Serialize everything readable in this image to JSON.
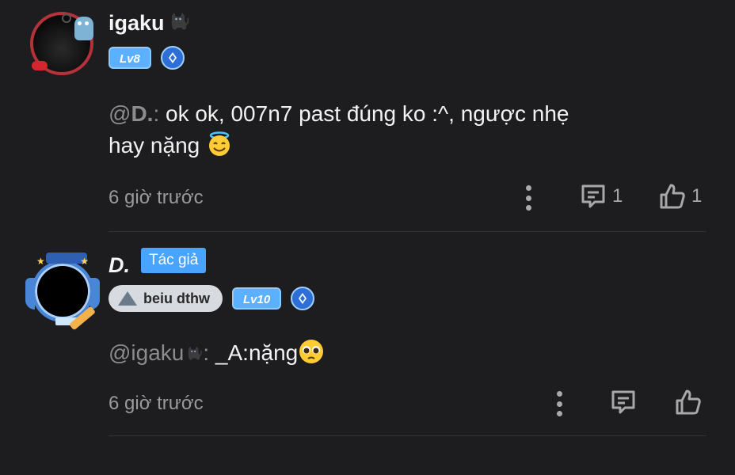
{
  "comments": [
    {
      "username": "igaku",
      "level": "Lv8",
      "mention": "@D.",
      "mention_sep": ":",
      "text": " ok ok, 007n7 past đúng ko :^, ngược nhẹ hay nặng",
      "time": "6 giờ trước",
      "reply_count": "1",
      "like_count": "1"
    },
    {
      "username": "D.",
      "author_tag": "Tác giả",
      "group": "beiu dthw",
      "level": "Lv10",
      "mention": "@igaku",
      "mention_sep": ":",
      "text": " _A:nặng",
      "time": "6 giờ trước"
    }
  ],
  "colors": {
    "background": "#1d1d1f",
    "accent": "#4aa4ff",
    "level_badge": "#5bb0ff",
    "muted_text": "#9a9a9a"
  },
  "icons": [
    "cat-icon",
    "tier-icon",
    "more-icon",
    "reply-icon",
    "like-icon",
    "smile-halo-emoji",
    "pleading-emoji"
  ]
}
